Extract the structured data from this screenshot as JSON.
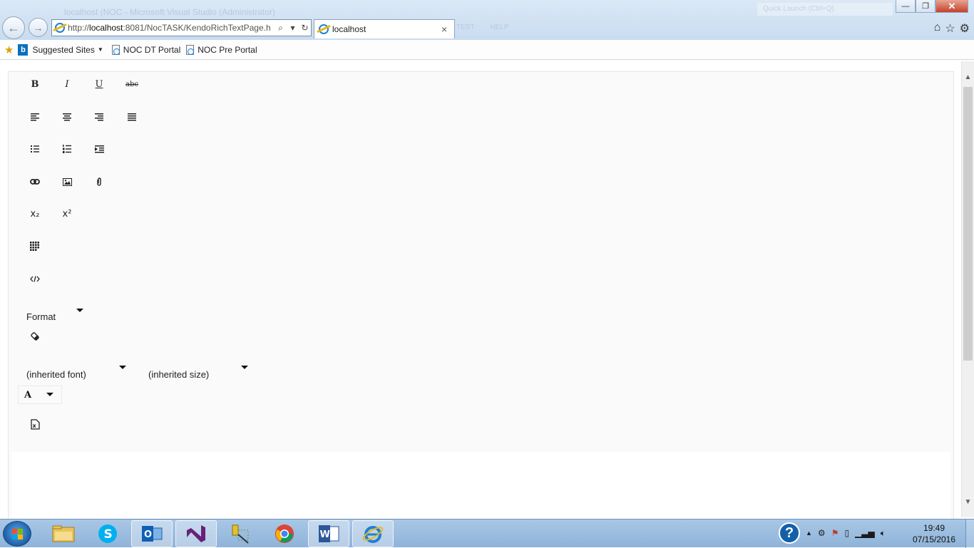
{
  "browser": {
    "address_scheme": "http://",
    "address_host": "localhost",
    "address_path": ":8081/NocTASK/KendoRichTextPage.h",
    "tab_title": "localhost",
    "tab_close": "×",
    "ghost_window_title": "localhost (NOC - Microsoft Visual Studio (Administrator)",
    "ghost_search": "Quick Launch (Ctrl+Q)",
    "ghost_tabs": [
      "TEST",
      "HELP"
    ]
  },
  "window_controls": {
    "minimize": "—",
    "restore": "❐",
    "close": "✕"
  },
  "favorites": {
    "suggested_sites": "Suggested Sites",
    "items": [
      "NOC DT Portal",
      "NOC Pre Portal"
    ]
  },
  "editor": {
    "tools": {
      "bold": "B",
      "italic": "I",
      "underline": "U",
      "strikethrough": "abc",
      "subscript": "x₂",
      "superscript": "x²"
    },
    "format_label": "Format",
    "font_label": "(inherited font)",
    "size_label": "(inherited size)",
    "fore_color_label": "A"
  },
  "taskbar": {
    "time": "19:49",
    "date": "07/15/2016",
    "help": "?"
  }
}
